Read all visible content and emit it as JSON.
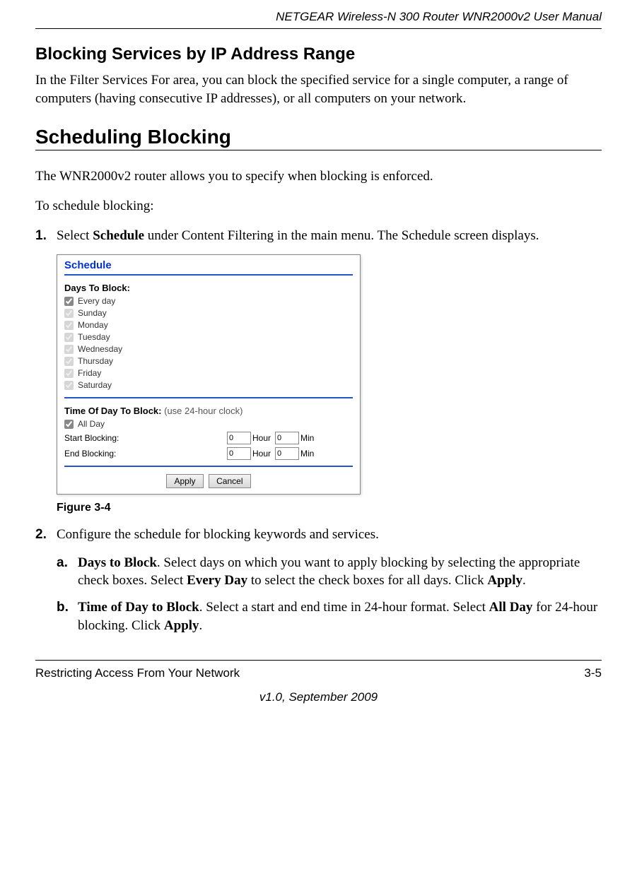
{
  "header": {
    "title": "NETGEAR Wireless-N 300 Router WNR2000v2 User Manual"
  },
  "section1": {
    "title": "Blocking Services by IP Address Range",
    "para": "In the Filter Services For area, you can block the specified service for a single computer, a range of computers (having consecutive IP addresses), or all computers on your network."
  },
  "section2": {
    "title": "Scheduling Blocking",
    "para1": "The WNR2000v2 router allows you to specify when blocking is enforced.",
    "para2": "To schedule blocking:",
    "step1": {
      "num": "1.",
      "pre": "Select ",
      "bold": "Schedule",
      "post": " under Content Filtering in the main menu. The Schedule screen displays."
    },
    "step2": {
      "num": "2.",
      "text": "Configure the schedule for blocking keywords and services."
    },
    "sub_a": {
      "num": "a.",
      "b1": "Days to Block",
      "t1": ". Select days on which you want to apply blocking by selecting the appropriate check boxes. Select ",
      "b2": "Every Day",
      "t2": " to select the check boxes for all days. Click ",
      "b3": "Apply",
      "t3": "."
    },
    "sub_b": {
      "num": "b.",
      "b1": "Time of Day to Block",
      "t1": ". Select a start and end time in 24-hour format. Select ",
      "b2": "All Day",
      "t2": " for 24-hour blocking. Click ",
      "b3": "Apply",
      "t3": "."
    }
  },
  "figure": {
    "caption": "Figure 3-4",
    "title": "Schedule",
    "days_label": "Days To Block:",
    "days": [
      "Every day",
      "Sunday",
      "Monday",
      "Tuesday",
      "Wednesday",
      "Thursday",
      "Friday",
      "Saturday"
    ],
    "time_label": "Time Of Day To Block:",
    "time_note": "(use 24-hour clock)",
    "allday": "All Day",
    "start": "Start Blocking:",
    "end": "End Blocking:",
    "hour": "Hour",
    "min": "Min",
    "val0": "0",
    "apply": "Apply",
    "cancel": "Cancel"
  },
  "footer": {
    "left": "Restricting Access From Your Network",
    "right": "3-5",
    "center": "v1.0, September 2009"
  }
}
